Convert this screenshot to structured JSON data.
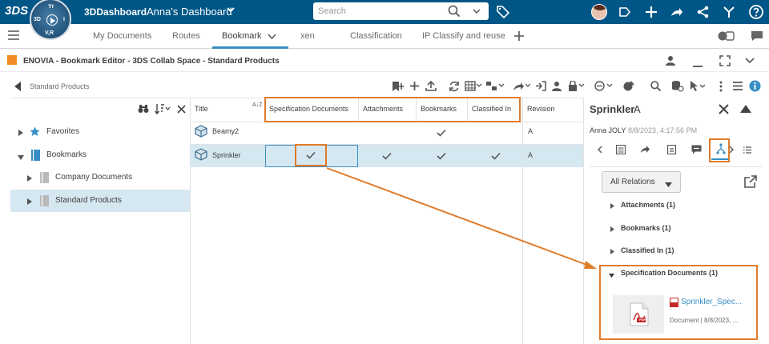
{
  "topbar": {
    "brand": "3DS",
    "compass": {
      "top": "Yr",
      "left": "3D",
      "right": "I",
      "bottom": "V,R"
    },
    "app_title": "3DDashboard",
    "dashboard_title": "Anna's Dashboard",
    "search_placeholder": "Search"
  },
  "tabs": [
    {
      "label": "My Documents"
    },
    {
      "label": "Routes"
    },
    {
      "label": "Bookmark"
    },
    {
      "label": "xen"
    },
    {
      "label": "Classification"
    },
    {
      "label": "IP Classify and reuse"
    }
  ],
  "widget": {
    "title": "ENOVIA - Bookmark Editor - 3DS Collab Space - Standard Products"
  },
  "breadcrumb": "Standard Products",
  "tree": {
    "items": [
      {
        "label": "Favorites"
      },
      {
        "label": "Bookmarks"
      },
      {
        "label": "Company Documents"
      },
      {
        "label": "Standard Products"
      }
    ]
  },
  "grid": {
    "columns": [
      "Title",
      "Specification Documents",
      "Attachments",
      "Bookmarks",
      "Classified In",
      "Revision"
    ],
    "sort_indicator": "A↓Z",
    "rows": [
      {
        "title": "Beamy2",
        "spec": false,
        "attach": false,
        "bookmarks": true,
        "classified": false,
        "revision": "A"
      },
      {
        "title": "Sprinkler",
        "spec": true,
        "attach": true,
        "bookmarks": true,
        "classified": true,
        "revision": "A"
      }
    ]
  },
  "panel": {
    "name": "Sprinkler",
    "revision": "A",
    "owner": "Anna JOLY",
    "modified": "8/8/2023, 4:17:56 PM",
    "filter": "All Relations",
    "relations": [
      {
        "label": "Attachments (1)"
      },
      {
        "label": "Bookmarks (1)"
      },
      {
        "label": "Classified In (1)"
      },
      {
        "label": "Specification Documents (1)"
      }
    ],
    "document": {
      "title": "Sprinkler_Spec...",
      "meta": "Document | 8/8/2023, ...",
      "thumb_label": "PDF"
    }
  },
  "colors": {
    "topbar": "#005686",
    "accent": "#368ec4",
    "highlight": "#e07b2a",
    "selection": "#d5e8f2"
  }
}
